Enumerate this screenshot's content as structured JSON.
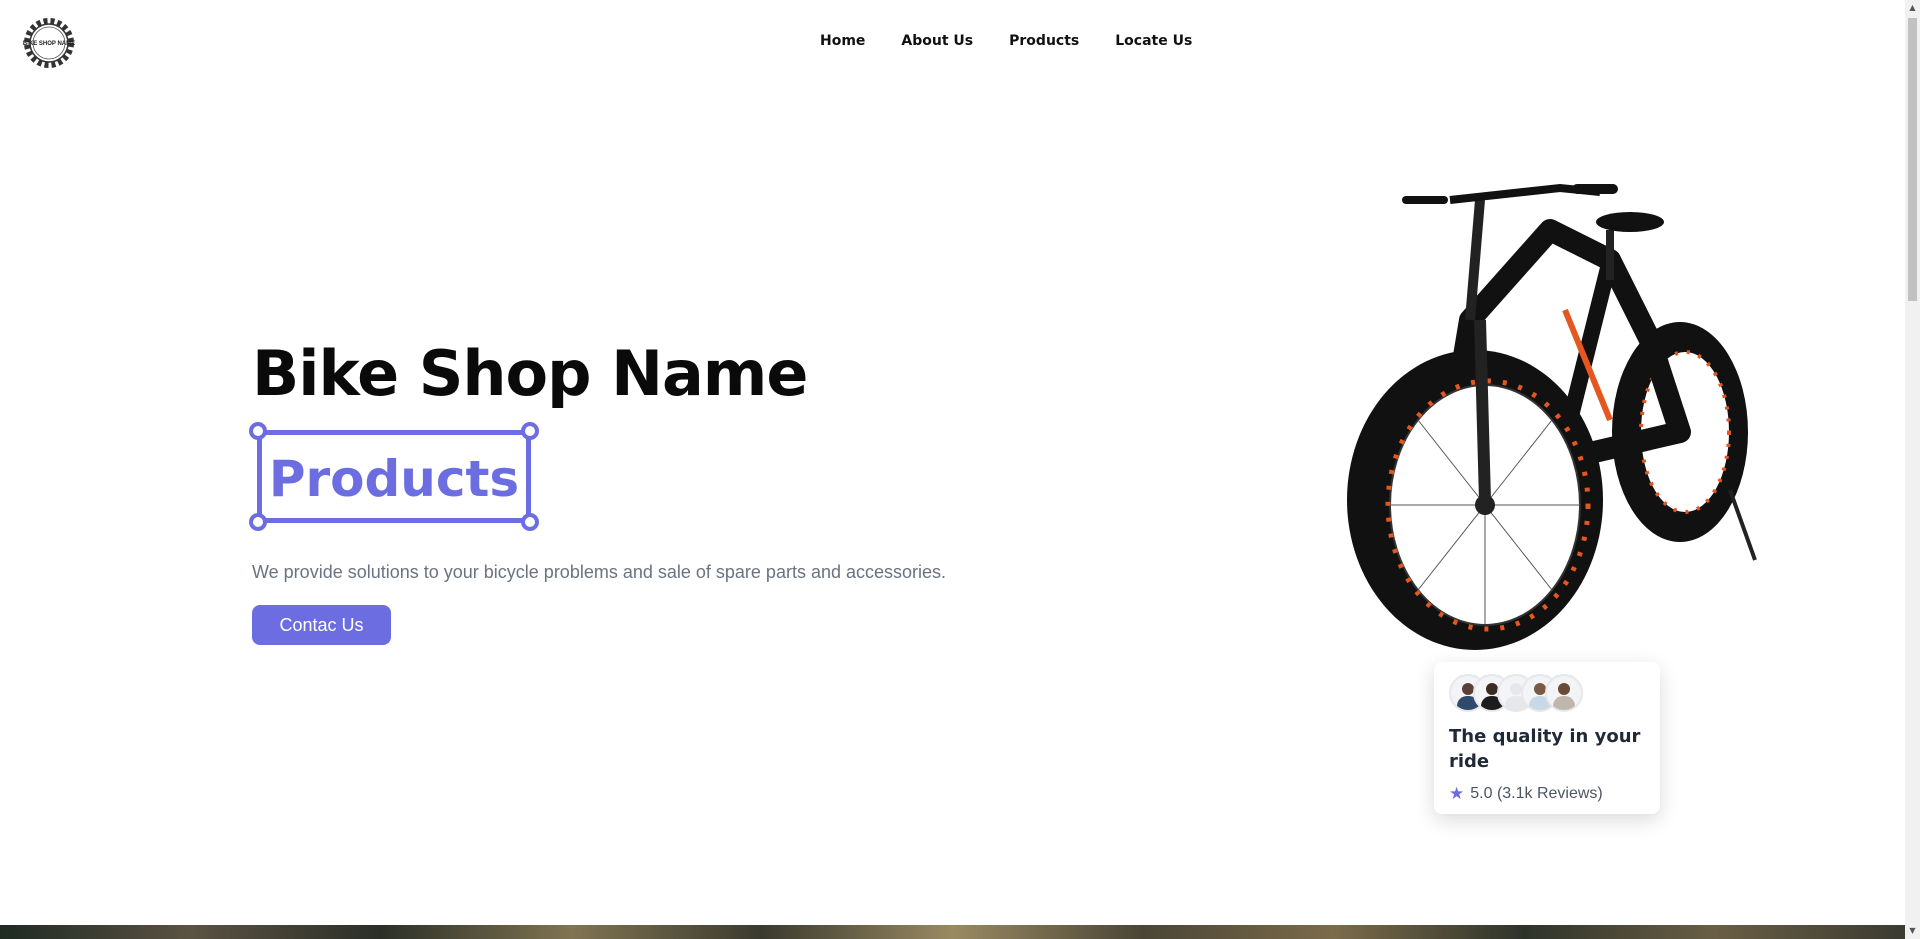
{
  "logo": {
    "text": "BIKE SHOP NAME"
  },
  "nav": {
    "items": [
      "Home",
      "About Us",
      "Products",
      "Locate Us"
    ]
  },
  "hero": {
    "title": "Bike Shop Name",
    "highlight": "Products",
    "description": "We provide solutions to your bicycle problems and sale of spare parts and accessories.",
    "cta_label": "Contac Us"
  },
  "review_card": {
    "title": "The quality in your ride",
    "rating_text": "5.0 (3.1k Reviews)",
    "rating_value": 5.0,
    "avatar_count": 5
  },
  "colors": {
    "accent": "#6c6de0",
    "text_muted": "#6b7280"
  }
}
